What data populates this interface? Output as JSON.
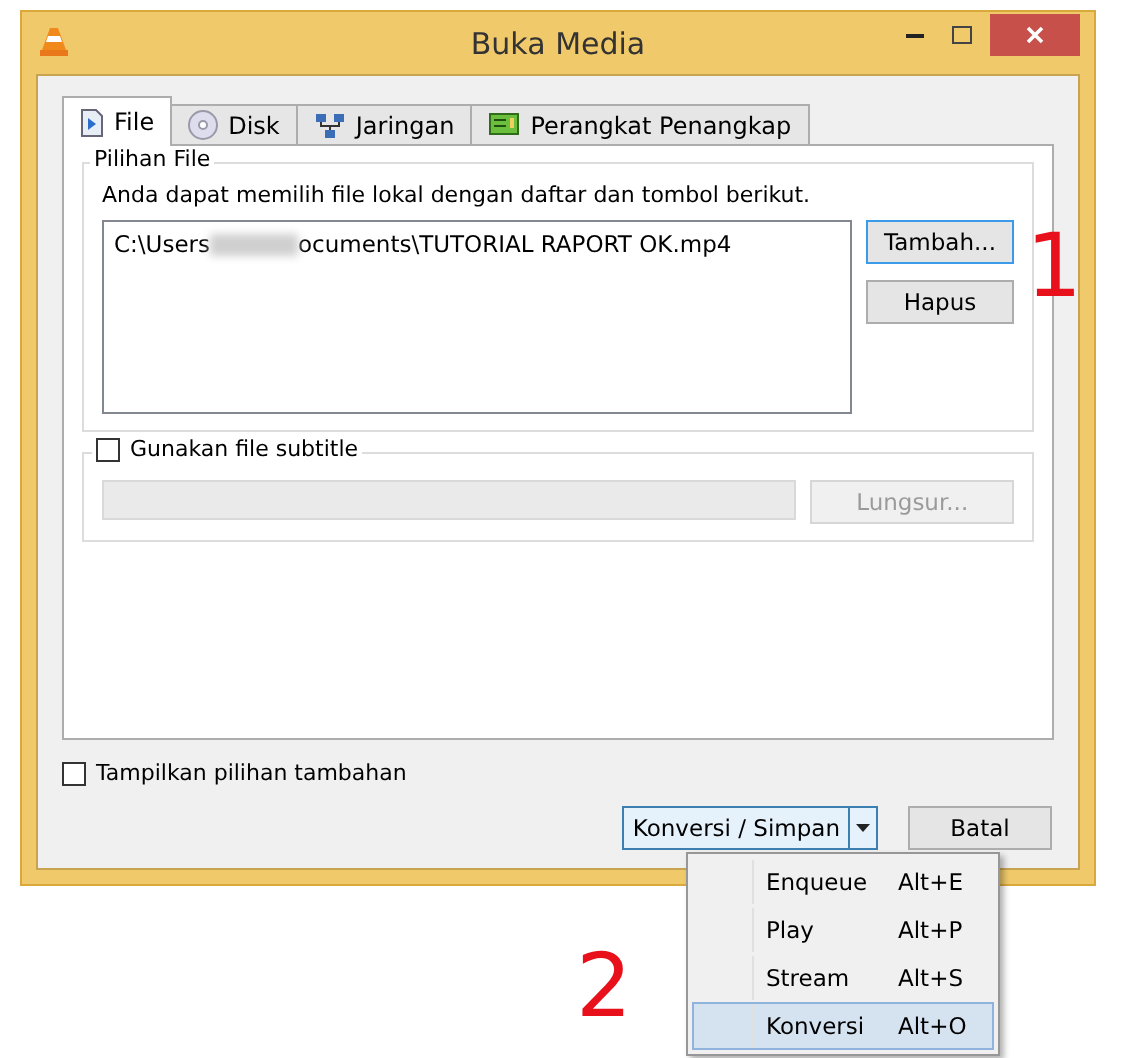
{
  "window": {
    "title": "Buka Media"
  },
  "tabs": [
    {
      "label": "File",
      "selected": true
    },
    {
      "label": "Disk",
      "selected": false
    },
    {
      "label": "Jaringan",
      "selected": false
    },
    {
      "label": "Perangkat Penangkap",
      "selected": false
    }
  ],
  "file_group": {
    "title": "Pilihan File",
    "hint": "Anda dapat memilih file lokal dengan daftar dan tombol berikut.",
    "files": [
      {
        "path_start": "C:\\Users",
        "path_end": "ocuments\\TUTORIAL RAPORT OK.mp4"
      }
    ],
    "buttons": [
      {
        "label": "Tambah...",
        "focused": true
      },
      {
        "label": "Hapus",
        "focused": false
      }
    ]
  },
  "subtitle_group": {
    "label": "Gunakan file subtitle",
    "checked": false,
    "browse_button": "Lungsur..."
  },
  "more_options": {
    "label": "Tampilkan pilihan tambahan",
    "checked": false
  },
  "actions": {
    "main": "Konversi / Simpan",
    "cancel": "Batal"
  },
  "menu": [
    {
      "label": "Enqueue",
      "shortcut": "Alt+E",
      "selected": false
    },
    {
      "label": "Play",
      "shortcut": "Alt+P",
      "selected": false
    },
    {
      "label": "Stream",
      "shortcut": "Alt+S",
      "selected": false
    },
    {
      "label": "Konversi",
      "shortcut": "Alt+O",
      "selected": true
    }
  ],
  "annotations": [
    "1",
    "2"
  ]
}
